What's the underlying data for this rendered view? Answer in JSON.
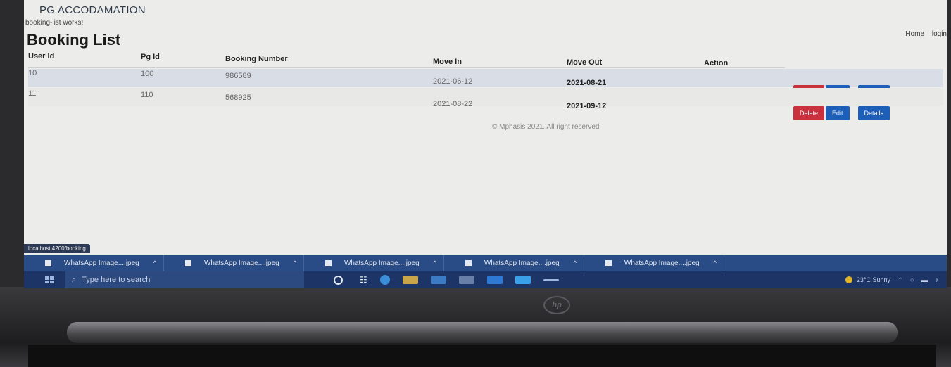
{
  "app": {
    "title": "PG ACCODAMATION",
    "status_text": "booking-list works!",
    "page_title": "Booking List",
    "nav": [
      "Home",
      "login"
    ]
  },
  "table": {
    "headers": [
      "User Id",
      "Pg Id",
      "Booking Number",
      "Move In",
      "Move Out",
      "Action"
    ],
    "rows": [
      {
        "user_id": "10",
        "pg_id": "100",
        "booking_number": "986589",
        "move_in": "2021-06-12",
        "move_out": "2021-08-21"
      },
      {
        "user_id": "11",
        "pg_id": "110",
        "booking_number": "568925",
        "move_in": "2021-08-22",
        "move_out": "2021-09-12"
      }
    ],
    "actions": {
      "delete": "Delete",
      "edit": "Edit",
      "details": "Details"
    }
  },
  "footer": "© Mphasis 2021. All right reserved",
  "browser": {
    "status_url": "localhost:4200/booking"
  },
  "downloads": [
    "WhatsApp Image....jpeg",
    "WhatsApp Image....jpeg",
    "WhatsApp Image....jpeg",
    "WhatsApp Image....jpeg",
    "WhatsApp Image....jpeg"
  ],
  "taskbar": {
    "search_placeholder": "Type here to search",
    "weather": "23°C Sunny"
  },
  "colors": {
    "delete": "#c9323d",
    "primary": "#1d5fb8",
    "taskbar": "#1c3466",
    "download_bar": "#2a4c86"
  },
  "icons": {
    "download_item": "file-icon",
    "chevron": "chevron-up-icon",
    "search": "search-icon",
    "windows": "windows-logo-icon"
  }
}
